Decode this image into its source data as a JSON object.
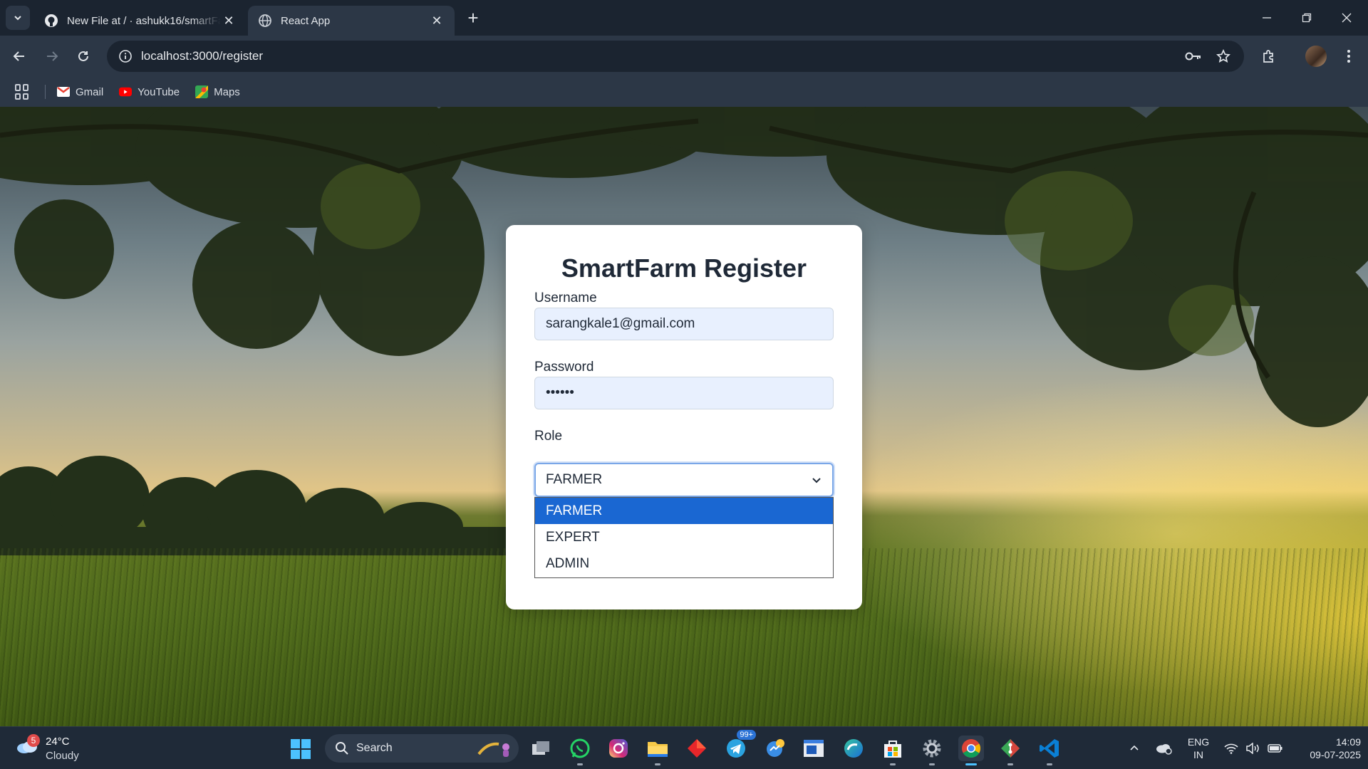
{
  "browser": {
    "tabs": [
      {
        "title": "New File at / · ashukk16/smartFarm",
        "icon": "github-icon"
      },
      {
        "title": "React App",
        "icon": "globe-icon"
      }
    ],
    "url": "localhost:3000/register",
    "bookmarks": [
      {
        "label": "Gmail",
        "icon": "gmail-icon"
      },
      {
        "label": "YouTube",
        "icon": "youtube-icon"
      },
      {
        "label": "Maps",
        "icon": "maps-icon"
      }
    ]
  },
  "form": {
    "title": "SmartFarm Register",
    "username_label": "Username",
    "username_value": "sarangkale1@gmail.com",
    "password_label": "Password",
    "password_value": "••••••",
    "role_label": "Role",
    "role_value": "FARMER",
    "role_options": [
      "FARMER",
      "EXPERT",
      "ADMIN"
    ],
    "accent_color": "#1a67d2"
  },
  "taskbar": {
    "weather": {
      "temp": "24°C",
      "condition": "Cloudy",
      "badge": "5"
    },
    "search_placeholder": "Search",
    "telegram_badge": "99+",
    "lang": [
      "ENG",
      "IN"
    ],
    "time": "14:09",
    "date": "09-07-2025"
  }
}
